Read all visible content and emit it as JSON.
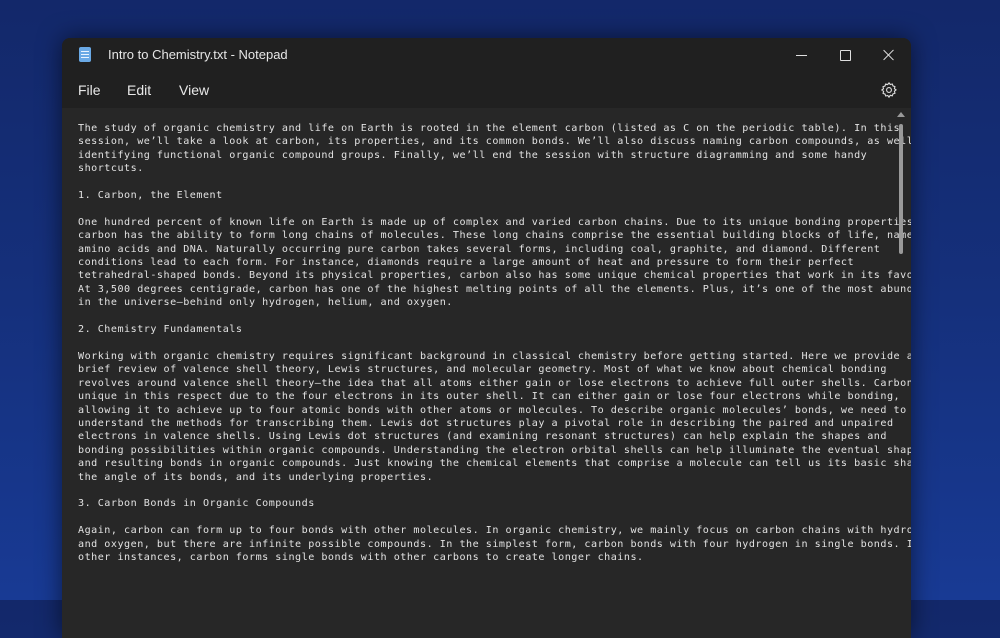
{
  "window": {
    "title": "Intro to Chemistry.txt - Notepad",
    "app_icon": "notepad-icon",
    "controls": {
      "minimize_icon": "minimize-icon",
      "maximize_icon": "maximize-icon",
      "close_icon": "close-icon"
    }
  },
  "menu": {
    "items": [
      "File",
      "Edit",
      "View"
    ],
    "settings_icon": "gear-icon"
  },
  "document": {
    "lines": [
      "The study of organic chemistry and life on Earth is rooted in the element carbon (listed as C on the periodic table). In this",
      "session, we’ll take a look at carbon, its properties, and its common bonds. We’ll also discuss naming carbon compounds, as well as",
      "identifying functional organic compound groups. Finally, we’ll end the session with structure diagramming and some handy",
      "shortcuts.",
      "",
      "1. Carbon, the Element",
      "",
      "One hundred percent of known life on Earth is made up of complex and varied carbon chains. Due to its unique bonding properties,",
      "carbon has the ability to form long chains of molecules. These long chains comprise the essential building blocks of life, namely",
      "amino acids and DNA. Naturally occurring pure carbon takes several forms, including coal, graphite, and diamond. Different",
      "conditions lead to each form. For instance, diamonds require a large amount of heat and pressure to form their perfect",
      "tetrahedral-shaped bonds. Beyond its physical properties, carbon also has some unique chemical properties that work in its favor.",
      "At 3,500 degrees centigrade, carbon has one of the highest melting points of all the elements. Plus, it’s one of the most abundant",
      "in the universe—behind only hydrogen, helium, and oxygen.",
      "",
      "2. Chemistry Fundamentals",
      "",
      "Working with organic chemistry requires significant background in classical chemistry before getting started. Here we provide a",
      "brief review of valence shell theory, Lewis structures, and molecular geometry. Most of what we know about chemical bonding",
      "revolves around valence shell theory—the idea that all atoms either gain or lose electrons to achieve full outer shells. Carbon is",
      "unique in this respect due to the four electrons in its outer shell. It can either gain or lose four electrons while bonding,",
      "allowing it to achieve up to four atomic bonds with other atoms or molecules. To describe organic molecules’ bonds, we need to",
      "understand the methods for transcribing them. Lewis dot structures play a pivotal role in describing the paired and unpaired",
      "electrons in valence shells. Using Lewis dot structures (and examining resonant structures) can help explain the shapes and",
      "bonding possibilities within organic compounds. Understanding the electron orbital shells can help illuminate the eventual shapes",
      "and resulting bonds in organic compounds. Just knowing the chemical elements that comprise a molecule can tell us its basic shape,",
      "the angle of its bonds, and its underlying properties.",
      "",
      "3. Carbon Bonds in Organic Compounds",
      "",
      "Again, carbon can form up to four bonds with other molecules. In organic chemistry, we mainly focus on carbon chains with hydrogen",
      "and oxygen, but there are infinite possible compounds. In the simplest form, carbon bonds with four hydrogen in single bonds. In",
      "other instances, carbon forms single bonds with other carbons to create longer chains."
    ]
  }
}
